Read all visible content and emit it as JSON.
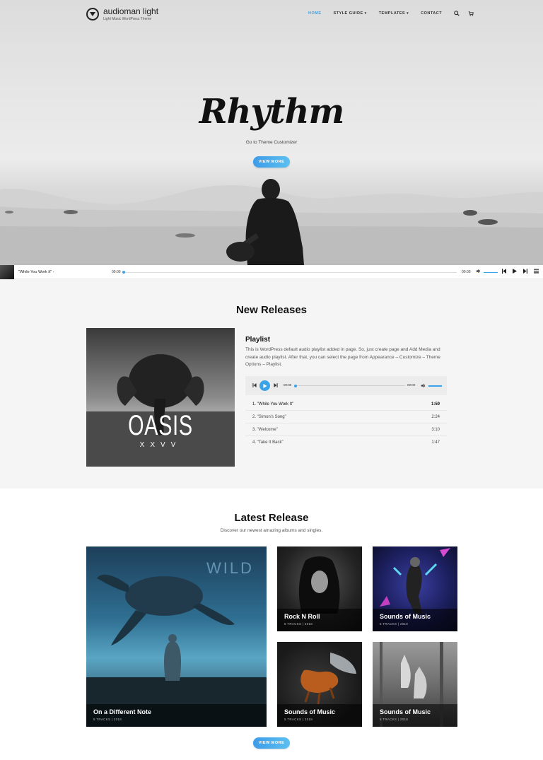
{
  "site": {
    "title": "audioman light",
    "tagline": "Light Music WordPress Theme"
  },
  "nav": {
    "home": "HOME",
    "style_guide": "STYLE GUIDE",
    "templates": "TEMPLATES",
    "contact": "CONTACT",
    "caret": "▾",
    "search_icon": "search-icon",
    "cart_icon": "cart-icon"
  },
  "hero": {
    "title": "Rhythm",
    "subtitle": "Go to Theme Customizer",
    "button": "VIEW MORE"
  },
  "player": {
    "track_title": "\"While You Work It\" -",
    "current_time": "00:00",
    "duration": "00:00",
    "progress": 0
  },
  "new_releases": {
    "heading": "New Releases",
    "album_title": "OASIS",
    "album_subtitle": "XXVV",
    "playlist_title": "Playlist",
    "playlist_desc": "This is WordPress default audio playlist added in page. So, just create page and Add Media and create audio playlist. After that, you can select the page from Appearance – Customize – Theme Options – Playlist.",
    "mini_player": {
      "current_time": "00:00",
      "duration": "00:00"
    },
    "tracks": [
      {
        "label": "1. \"While You Work It\"",
        "length": "1:59"
      },
      {
        "label": "2. \"Simon's Song\"",
        "length": "2:24"
      },
      {
        "label": "3. \"Welcome\"",
        "length": "3:10"
      },
      {
        "label": "4. \"Take It Back\"",
        "length": "1:47"
      }
    ]
  },
  "latest_release": {
    "heading": "Latest Release",
    "subheading": "Discover our newest amazing albums and singles.",
    "button": "VIEW MORE",
    "cards": [
      {
        "title": "On a Different Note",
        "meta": "5 TRACKS  |  2018",
        "art_text": "WILD"
      },
      {
        "title": "Rock N Roll",
        "meta": "5 TRACKS  |  2018"
      },
      {
        "title": "Sounds of Music",
        "meta": "5 TRACKS  |  2018"
      },
      {
        "title": "Sounds of Music",
        "meta": "5 TRACKS  |  2018"
      },
      {
        "title": "Sounds of Music",
        "meta": "5 TRACKS  |  2018"
      }
    ]
  }
}
